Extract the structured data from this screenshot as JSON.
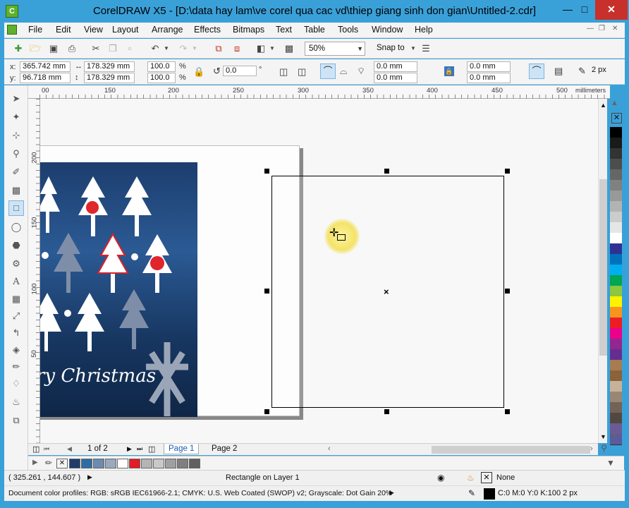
{
  "window": {
    "title": "CorelDRAW X5 - [D:\\data hay lam\\ve corel qua cac vd\\thiep giang sinh don gian\\Untitled-2.cdr]",
    "app_icon": "coreldraw-icon"
  },
  "menu": [
    "File",
    "Edit",
    "View",
    "Layout",
    "Arrange",
    "Effects",
    "Bitmaps",
    "Text",
    "Table",
    "Tools",
    "Window",
    "Help"
  ],
  "standard_toolbar": {
    "zoom_value": "50%",
    "snap_label": "Snap to"
  },
  "property_bar": {
    "x": "365.742 mm",
    "y": "96.718 mm",
    "width": "178.329 mm",
    "height": "178.329 mm",
    "scale_x": "100.0",
    "scale_y": "100.0",
    "percent": "%",
    "rotation": "0.0",
    "degree": "°",
    "corner1": "0.0 mm",
    "corner2": "0.0 mm",
    "corner3": "0.0 mm",
    "corner4": "0.0 mm",
    "outline_width": "2 px",
    "x_label": "x:",
    "y_label": "y:"
  },
  "rulers": {
    "unit": "millimeters",
    "h_ticks": [
      "00",
      "150",
      "200",
      "250",
      "300",
      "350",
      "400",
      "450",
      "500"
    ],
    "v_ticks": [
      "200",
      "150",
      "100",
      "50"
    ]
  },
  "artwork": {
    "greeting": "ry Christmas"
  },
  "page_nav": {
    "position": "1 of 2",
    "tabs": [
      "Page 1",
      "Page 2"
    ]
  },
  "status": {
    "coords": "( 325.261 , 144.607 )",
    "object_info": "Rectangle on Layer 1",
    "fill_label": "None",
    "color_profiles": "Document color profiles: RGB: sRGB IEC61966-2.1; CMYK: U.S. Web Coated (SWOP) v2; Grayscale: Dot Gain 20%",
    "outline_info": "C:0 M:0 Y:0 K:100  2 px"
  },
  "colors": {
    "accent": "#3aa0d8",
    "close": "#c7302b",
    "artwork_bg": "#1d3e6e"
  },
  "palette": [
    "#000000",
    "#1a1a1a",
    "#333333",
    "#4d4d4d",
    "#666666",
    "#808080",
    "#999999",
    "#b3b3b3",
    "#cccccc",
    "#e6e6e6",
    "#ffffff",
    "#2e3192",
    "#0072bc",
    "#00aeef",
    "#00a651",
    "#8dc63f",
    "#fff200",
    "#f7941d",
    "#ed1c24",
    "#ec008c",
    "#92278f",
    "#662d91",
    "#a67c52",
    "#8c6239",
    "#c7b299",
    "#998675",
    "#736357",
    "#534741",
    "#6b5b95",
    "#5a5a9c"
  ],
  "doc_palette": [
    "#1f3c6b",
    "#2e6da4",
    "#6d8ab0",
    "#9aa9be",
    "#ffffff",
    "#e21b24",
    "#b5b5b5",
    "#c9c9c9",
    "#a0a0a0",
    "#7f7f7f",
    "#606060"
  ]
}
